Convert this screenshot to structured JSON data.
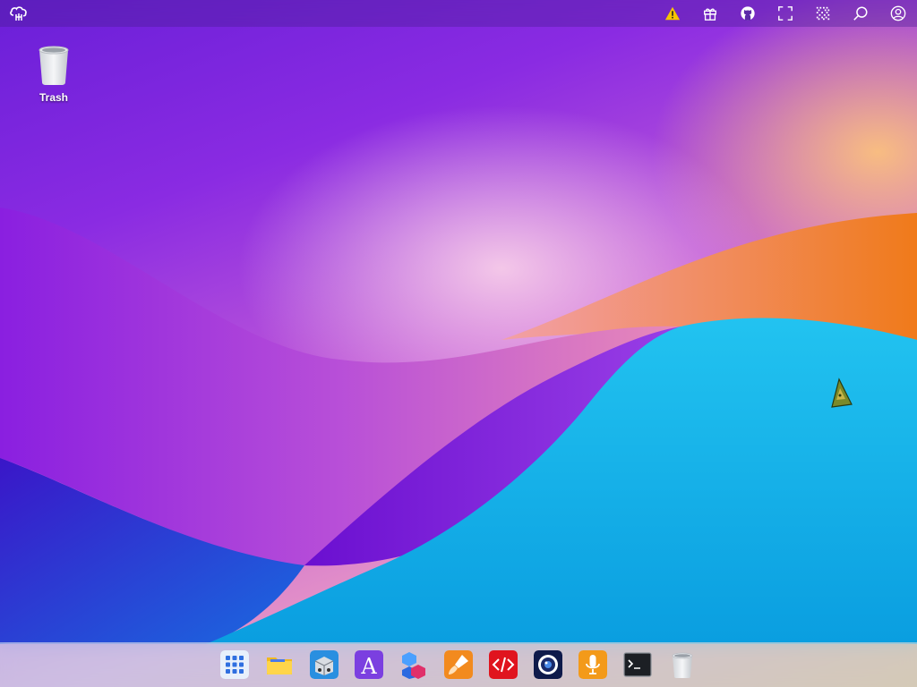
{
  "desktop": {
    "icons": [
      {
        "label": "Trash",
        "icon": "trash-icon"
      }
    ]
  },
  "topbar": {
    "logo_icon": "cloud-logo-icon",
    "tray_icons": [
      "warning-icon",
      "gift-icon",
      "github-icon",
      "fullscreen-icon",
      "qr-code-icon",
      "search-icon",
      "user-account-icon"
    ]
  },
  "dock": {
    "items": [
      "app-launcher-icon",
      "file-manager-icon",
      "package-store-icon",
      "font-viewer-icon",
      "cubes-app-icon",
      "paint-brush-app-icon",
      "code-editor-icon",
      "camera-app-icon",
      "voice-recorder-icon",
      "terminal-icon",
      "trash-icon"
    ]
  },
  "colors": {
    "accent_blue": "#1e9bff",
    "warning_yellow": "#f5c400",
    "dock_background": "#bfe6f5"
  }
}
